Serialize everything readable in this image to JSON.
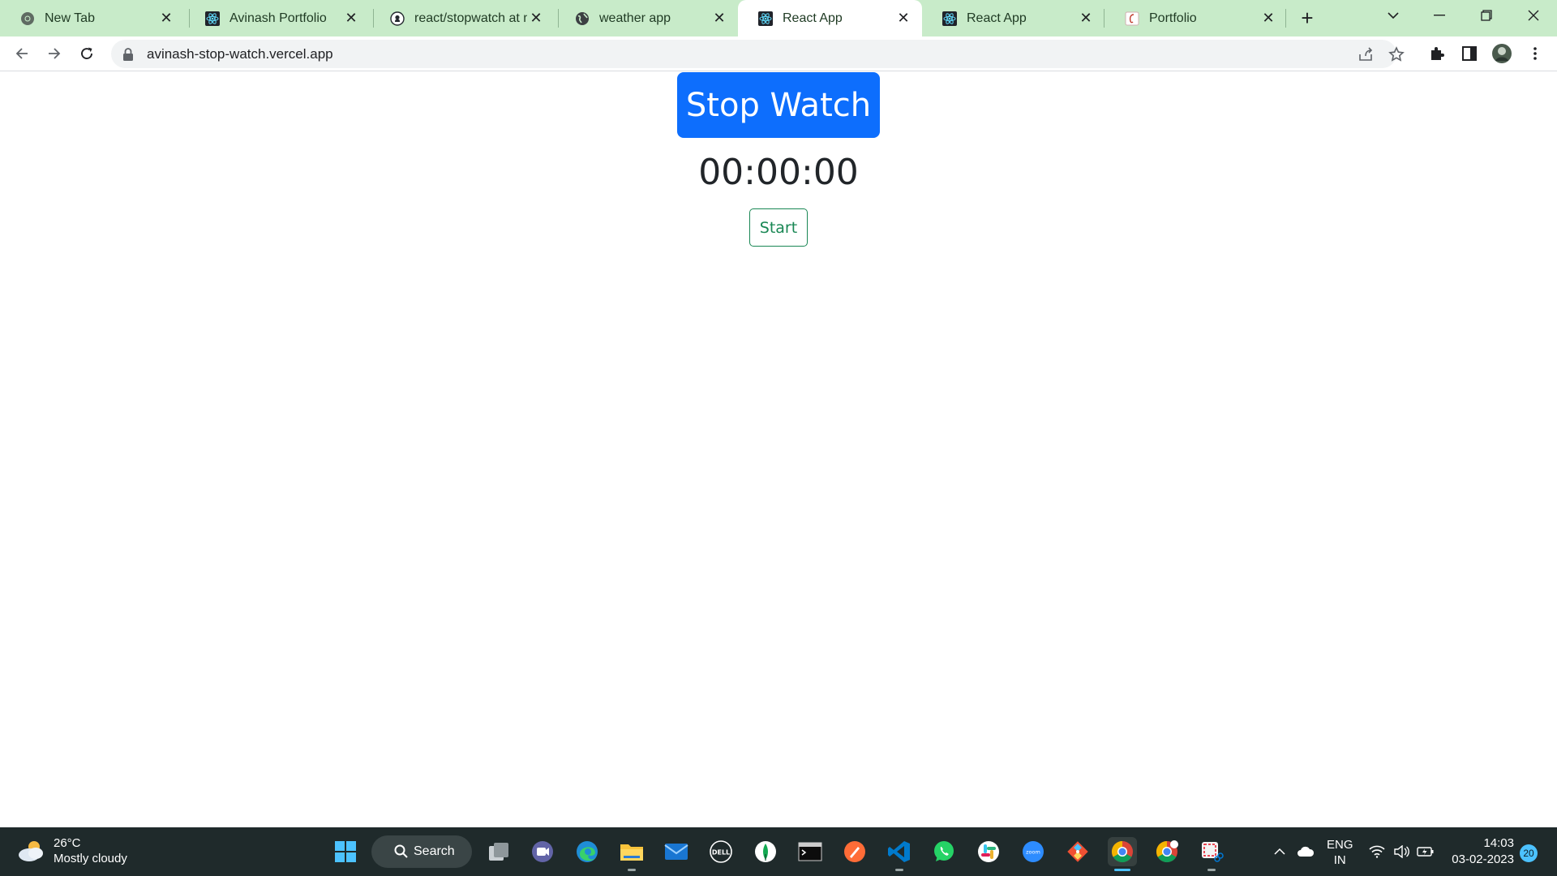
{
  "browser": {
    "tabs": [
      {
        "title": "New Tab",
        "icon": "chrome-icon",
        "active": false
      },
      {
        "title": "Avinash Portfolio",
        "icon": "react-icon",
        "active": false
      },
      {
        "title": "react/stopwatch at ma",
        "icon": "github-icon",
        "active": false
      },
      {
        "title": "weather app",
        "icon": "globe-icon",
        "active": false
      },
      {
        "title": "React App",
        "icon": "react-icon",
        "active": true
      },
      {
        "title": "React App",
        "icon": "react-icon",
        "active": false
      },
      {
        "title": "Portfolio",
        "icon": "portfolio-icon",
        "active": false
      }
    ],
    "address": {
      "url": "avinash-stop-watch.vercel.app"
    },
    "colors": {
      "tabstrip": "#c8ebc9",
      "active_tab": "#ffffff"
    }
  },
  "page": {
    "heading": "Stop Watch",
    "timer": "00:00:00",
    "start_label": "Start",
    "colors": {
      "heading_bg": "#0d6efd",
      "start_border": "#198754"
    }
  },
  "taskbar": {
    "weather": {
      "temp": "26°C",
      "condition": "Mostly cloudy"
    },
    "search_label": "Search",
    "apps": [
      "windows-start-icon",
      "task-view-icon",
      "teams-chat-icon",
      "edge-icon",
      "file-explorer-icon",
      "mail-icon",
      "dell-icon",
      "mongodb-compass-icon",
      "terminal-icon",
      "postman-icon",
      "vscode-icon",
      "whatsapp-icon",
      "slack-icon",
      "zoom-icon",
      "git-icon",
      "chrome-icon",
      "chrome-profile-icon",
      "snipping-tool-icon"
    ],
    "language": {
      "line1": "ENG",
      "line2": "IN"
    },
    "clock": {
      "time": "14:03",
      "date": "03-02-2023"
    },
    "notifications": "20"
  }
}
